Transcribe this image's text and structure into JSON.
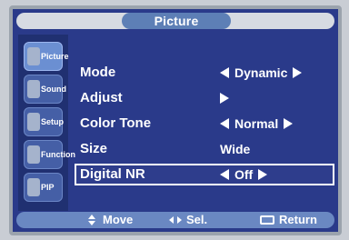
{
  "title": "Picture",
  "menu": {
    "rows": [
      {
        "label": "Mode",
        "value": "Dynamic",
        "left_arrow": true,
        "right_arrow": true
      },
      {
        "label": "Adjust",
        "value": "",
        "left_arrow": false,
        "right_arrow": true
      },
      {
        "label": "Color Tone",
        "value": "Normal",
        "left_arrow": true,
        "right_arrow": true
      },
      {
        "label": "Size",
        "value": "Wide",
        "left_arrow": false,
        "right_arrow": false
      },
      {
        "label": "Digital NR",
        "value": "Off",
        "left_arrow": true,
        "right_arrow": true
      }
    ],
    "selected_row": "Digital NR"
  },
  "footer": {
    "move_label": "Move",
    "select_label": "Sel.",
    "return_label": "Return"
  },
  "left_nav": {
    "items": [
      {
        "label": "Picture",
        "icon": "picture-icon",
        "active": true
      },
      {
        "label": "Sound",
        "icon": "sound-icon",
        "active": false
      },
      {
        "label": "Setup",
        "icon": "setup-icon",
        "active": false
      },
      {
        "label": "Function",
        "icon": "function-icon",
        "active": false
      },
      {
        "label": "PIP",
        "icon": "pip-icon",
        "active": false
      }
    ]
  },
  "colors": {
    "panel_blue": "#2a3a8a",
    "title_pill": "#5d7fb6",
    "nav_blue": "#203071",
    "footer_blue": "#6a88c2",
    "text_white": "#ffffff"
  }
}
